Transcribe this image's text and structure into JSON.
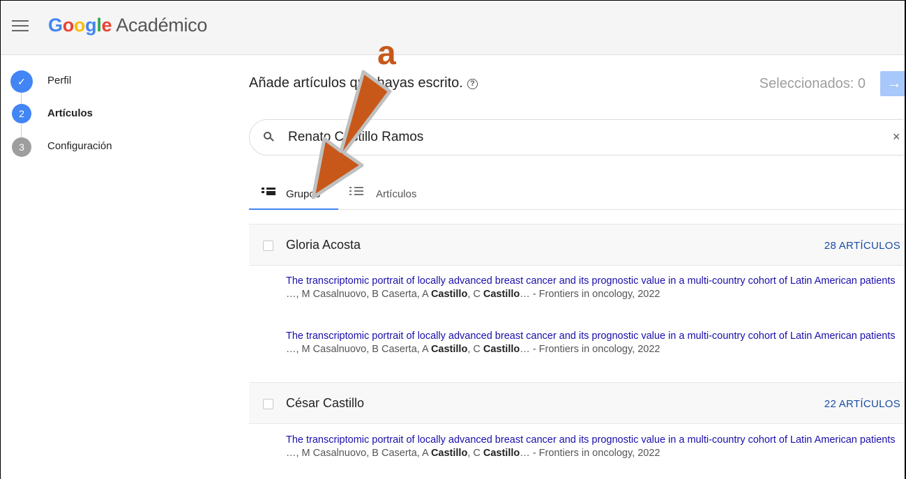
{
  "header": {
    "logo_word": "Google",
    "logo_suffix": "Académico"
  },
  "steps": [
    {
      "number": "✓",
      "label": "Perfil",
      "state": "done"
    },
    {
      "number": "2",
      "label": "Artículos",
      "state": "active"
    },
    {
      "number": "3",
      "label": "Configuración",
      "state": "todo"
    }
  ],
  "main": {
    "title": "Añade artículos que hayas escrito.",
    "help": "?",
    "selected": "Seleccionados: 0",
    "next_icon": "→"
  },
  "search": {
    "value": "Renato Castillo Ramos",
    "clear": "×"
  },
  "tabs": [
    {
      "label": "Grupos",
      "active": true
    },
    {
      "label": "Artículos",
      "active": false
    }
  ],
  "groups": [
    {
      "name": "Gloria Acosta",
      "count": "28 ARTÍCULOS",
      "articles": [
        {
          "title": "The transcriptomic portrait of locally advanced breast cancer and its prognostic value in a multi-country cohort of Latin American patients",
          "meta_prefix": "…, M Casalnuovo, B Caserta, A ",
          "meta_bold1": "Castillo",
          "meta_mid": ", C ",
          "meta_bold2": "Castillo",
          "meta_suffix": "… - Frontiers in oncology, 2022"
        },
        {
          "title": "The transcriptomic portrait of locally advanced breast cancer and its prognostic value in a multi-country cohort of Latin American patients",
          "meta_prefix": "…, M Casalnuovo, B Caserta, A ",
          "meta_bold1": "Castillo",
          "meta_mid": ", C ",
          "meta_bold2": "Castillo",
          "meta_suffix": "… - Frontiers in oncology, 2022"
        }
      ]
    },
    {
      "name": "César Castillo",
      "count": "22 ARTÍCULOS",
      "articles": [
        {
          "title": "The transcriptomic portrait of locally advanced breast cancer and its prognostic value in a multi-country cohort of Latin American patients",
          "meta_prefix": "…, M Casalnuovo, B Caserta, A ",
          "meta_bold1": "Castillo",
          "meta_mid": ", C ",
          "meta_bold2": "Castillo",
          "meta_suffix": "… - Frontiers in oncology, 2022"
        }
      ]
    }
  ],
  "annotation": {
    "letter": "a",
    "color": "#c8581a"
  }
}
